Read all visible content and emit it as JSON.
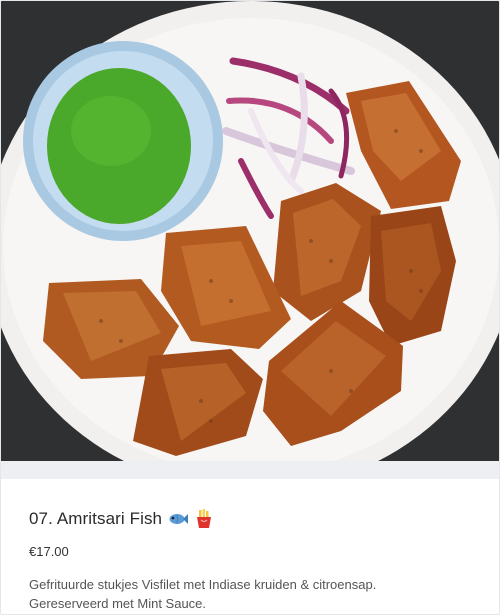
{
  "item": {
    "title": "07. Amritsari Fish",
    "emoji_icons": [
      "fish-emoji",
      "fries-emoji"
    ],
    "price": "€17.00",
    "description_line1": "Gefrituurde stukjes Visfilet met Indiase kruiden & citroensap.",
    "description_line2": "Gereserveerd met Mint Sauce."
  },
  "colors": {
    "text_primary": "#2b2b2b",
    "text_secondary": "#555555",
    "divider_band": "#eeeff3",
    "photo_background": "#2d2f31"
  }
}
